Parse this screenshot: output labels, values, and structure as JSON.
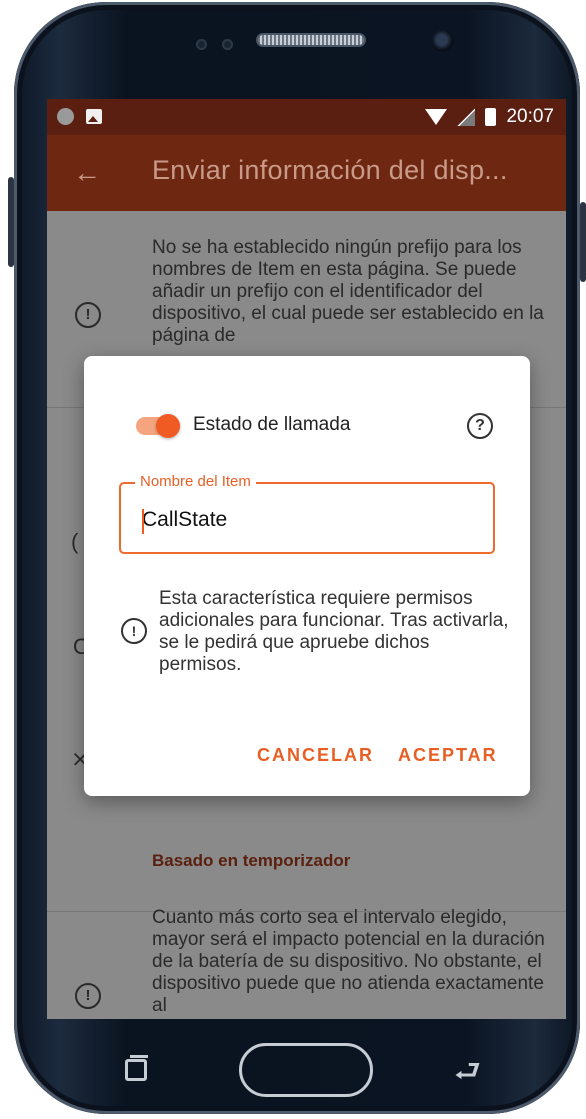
{
  "status_bar": {
    "time": "20:07"
  },
  "app_bar": {
    "title": "Enviar información del disp..."
  },
  "background": {
    "info_text_1": "No se ha establecido ningún prefijo para los nombres de Item en esta página. Se puede añadir un prefijo con el identificador del dispositivo, el cual puede ser establecido en la página de",
    "section_heading": "Basado en temporizador",
    "info_text_2": "Cuanto más corto sea el intervalo elegido, mayor será el impacto potencial en la duración de la batería de su dispositivo. No obstante, el dispositivo puede que no atienda exactamente al"
  },
  "dialog": {
    "switch_label": "Estado de llamada",
    "switch_on": true,
    "field_label": "Nombre del Item",
    "field_value": "CallState",
    "warning_text": "Esta característica requiere permisos adicionales para funcionar. Tras activarla, se le pedirá que apruebe dichos permisos.",
    "cancel_label": "CANCELAR",
    "accept_label": "ACEPTAR"
  },
  "colors": {
    "accent": "#ef6a2e",
    "appbar": "#6e2812",
    "statusbar": "#5a1f10"
  },
  "icons": [
    "back-arrow-icon",
    "info-icon",
    "help-icon",
    "wifi-icon",
    "no-signal-icon",
    "battery-icon",
    "recent-apps-icon",
    "home-icon",
    "back-icon"
  ]
}
